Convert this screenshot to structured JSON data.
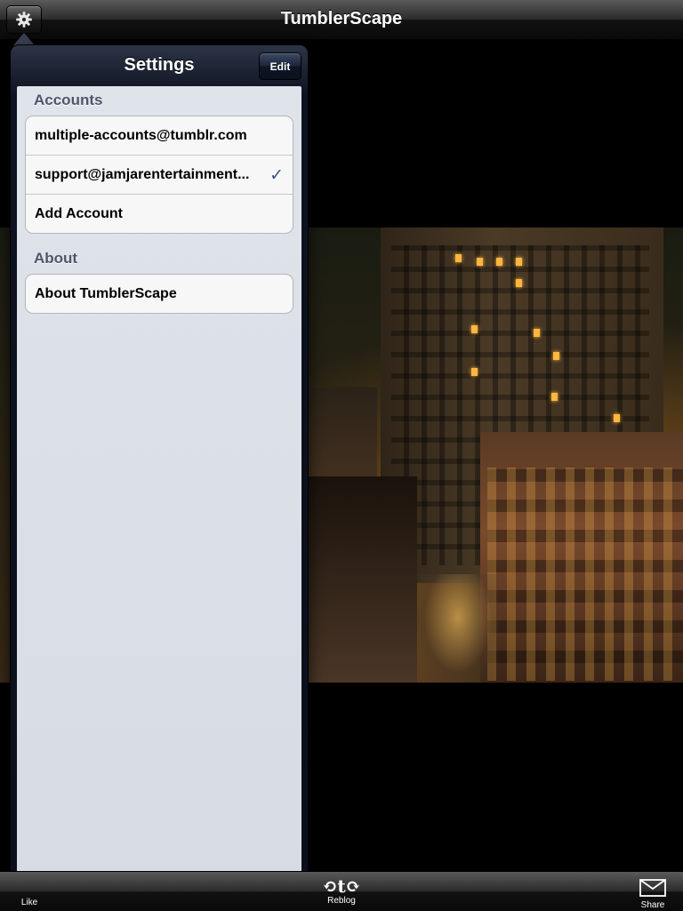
{
  "header": {
    "title": "TumblerScape",
    "settings_icon": "gear-icon"
  },
  "popover": {
    "title": "Settings",
    "edit_label": "Edit",
    "accounts_header": "Accounts",
    "accounts": [
      {
        "label": "multiple-accounts@tumblr.com",
        "selected": false
      },
      {
        "label": "support@jamjarentertainment...",
        "selected": true
      },
      {
        "label": "Add Account",
        "selected": false
      }
    ],
    "checkmark": "✓",
    "about_header": "About",
    "about_items": [
      {
        "label": "About TumblerScape"
      }
    ]
  },
  "toolbar": {
    "like_label": "Like",
    "reblog_label": "Reblog",
    "share_label": "Share",
    "reblog_glyph": "⟲t⟳"
  },
  "colors": {
    "section_header": "#4c566c",
    "checkmark": "#385487",
    "popover_bg": "#0d1220"
  }
}
